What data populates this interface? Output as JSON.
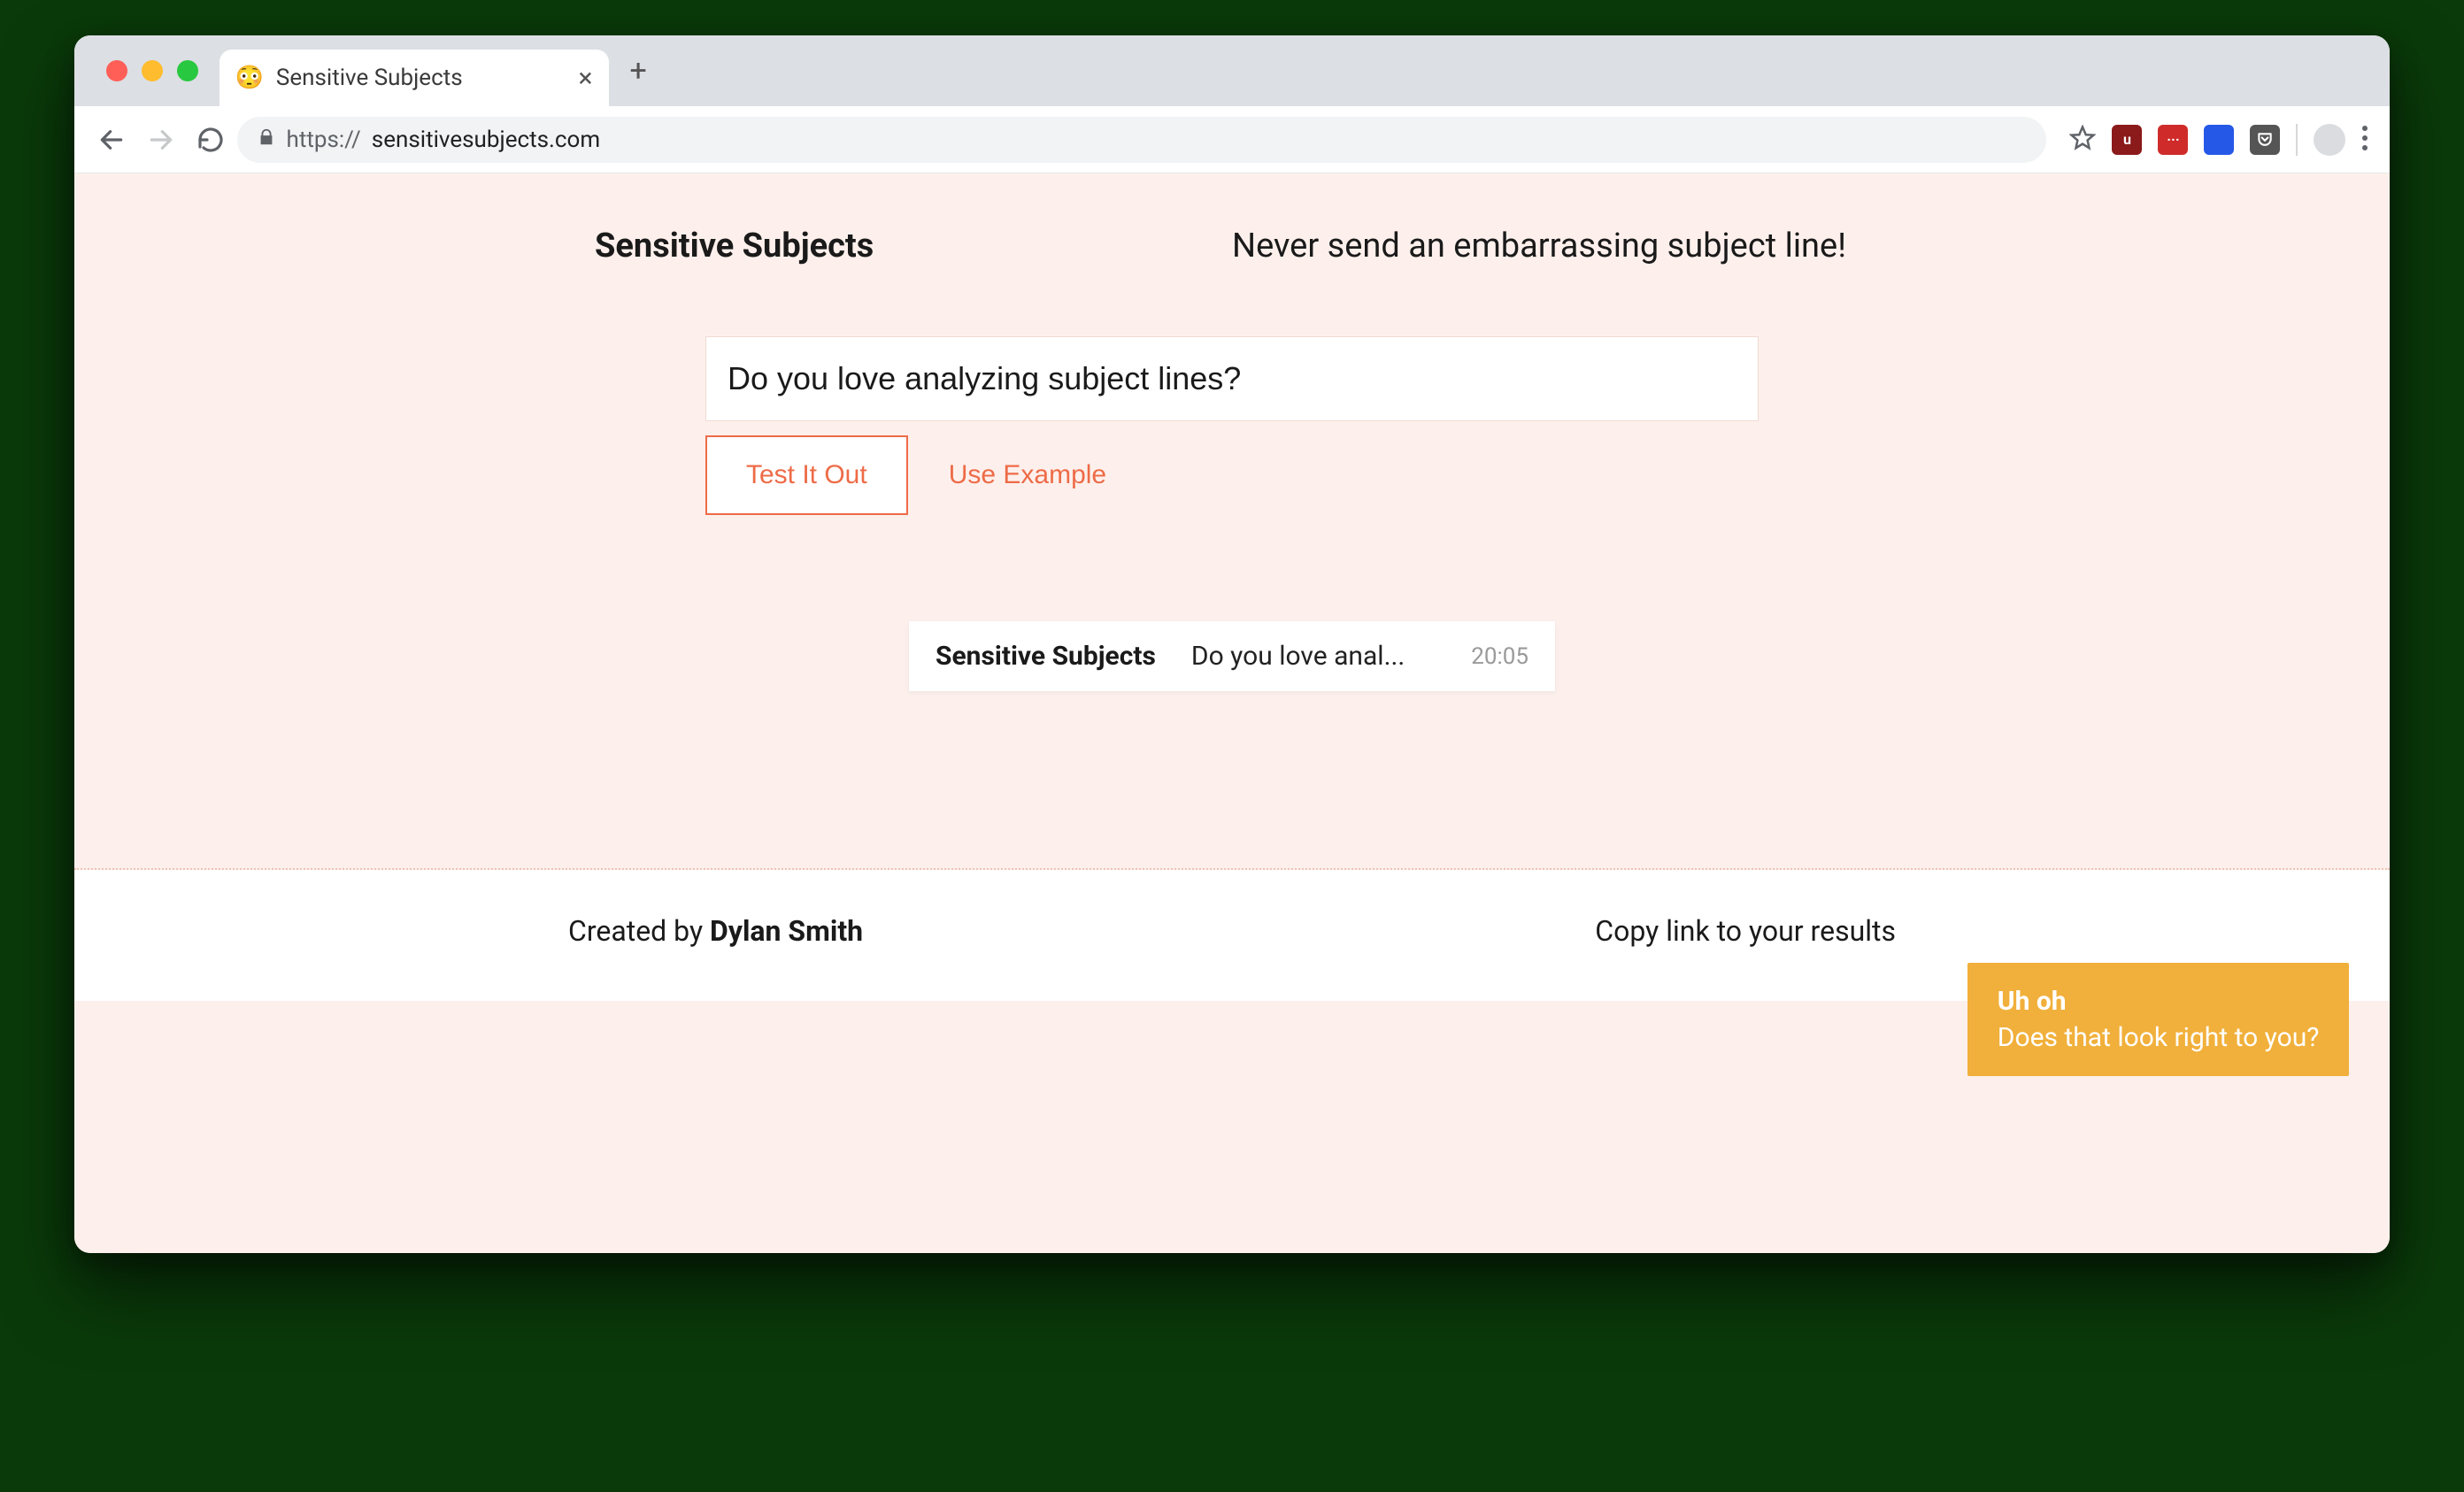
{
  "browser": {
    "tab_title": "Sensitive Subjects",
    "favicon_emoji": "😳",
    "url_prefix": "https://",
    "url_host": "sensitivesubjects.com"
  },
  "header": {
    "site_title": "Sensitive Subjects",
    "tagline": "Never send an embarrassing subject line!"
  },
  "form": {
    "subject_value": "Do you love analyzing subject lines?",
    "test_button": "Test It Out",
    "example_link": "Use Example"
  },
  "preview": {
    "sender": "Sensitive Subjects",
    "snippet": "Do you love anal...",
    "time": "20:05"
  },
  "toast": {
    "title": "Uh oh",
    "body": "Does that look right to you?"
  },
  "footer": {
    "created_by_prefix": "Created by ",
    "author": "Dylan Smith",
    "copy_link": "Copy link to your results"
  },
  "colors": {
    "accent": "#ee6b47",
    "page_bg": "#fdf0ec",
    "toast_bg": "#f1b03b"
  }
}
